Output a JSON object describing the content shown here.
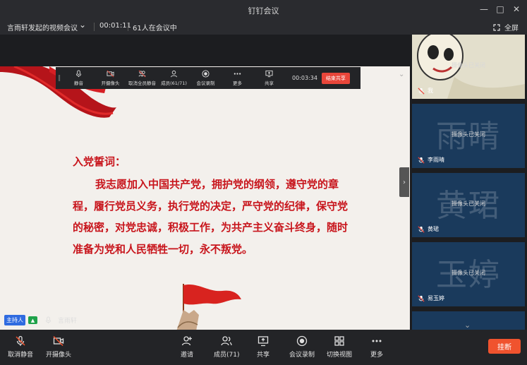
{
  "window": {
    "title": "钉钉会议"
  },
  "infobar": {
    "meeting_name": "言雨轩发起的视频会议",
    "duration": "00:01:11",
    "participants_in_meeting": "61人在会议中",
    "fullscreen_label": "全屏"
  },
  "share_toolbar": {
    "items": [
      "静音",
      "开摄像头",
      "取消全员静音",
      "成员(61/71)",
      "会议录制",
      "更多",
      "共享"
    ],
    "timer": "00:03:34",
    "stop_label": "结束共享"
  },
  "slide": {
    "title": "入党誓词：",
    "body": "我志愿加入中国共产党，拥护党的纲领，遵守党的章程，履行党员义务，执行党的决定，严守党的纪律，保守党的秘密，对党忠诚，积极工作，为共产主义奋斗终身，随时准备为党和人民牺牲一切，永不叛党。"
  },
  "host": {
    "badge": "主持人",
    "name": "言雨轩"
  },
  "participants": [
    {
      "name": "我",
      "status": "摄像头已关闭",
      "big": ""
    },
    {
      "name": "李雨晴",
      "status": "摄像头已关闭",
      "big": "雨晴"
    },
    {
      "name": "黄珺",
      "status": "摄像头已关闭",
      "big": "黄珺"
    },
    {
      "name": "易玉婷",
      "status": "摄像头已关闭",
      "big": "玉婷"
    }
  ],
  "bottom_toolbar": {
    "unmute": "取消静音",
    "camera": "开摄像头",
    "invite": "邀请",
    "members": "成员(71)",
    "share": "共享",
    "record": "会议录制",
    "switch_view": "切换视图",
    "more": "更多",
    "hangup": "挂断"
  },
  "colors": {
    "accent_red": "#c8151c",
    "host_blue": "#2f6be0",
    "hangup": "#f0532e",
    "tile_blue": "#1a3a5c"
  }
}
